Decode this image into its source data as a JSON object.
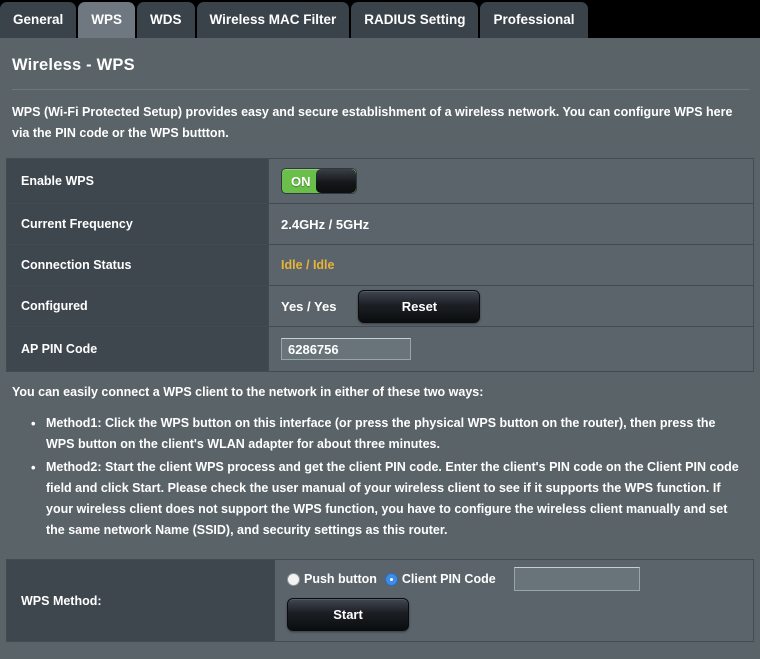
{
  "tabs": [
    {
      "label": "General",
      "active": false
    },
    {
      "label": "WPS",
      "active": true
    },
    {
      "label": "WDS",
      "active": false
    },
    {
      "label": "Wireless MAC Filter",
      "active": false
    },
    {
      "label": "RADIUS Setting",
      "active": false
    },
    {
      "label": "Professional",
      "active": false
    }
  ],
  "page": {
    "title": "Wireless - WPS",
    "description": "WPS (Wi-Fi Protected Setup) provides easy and secure establishment of a wireless network. You can configure WPS here via the PIN code or the WPS buttton."
  },
  "settings": {
    "enable_wps": {
      "label": "Enable WPS",
      "toggle_state": "ON"
    },
    "current_frequency": {
      "label": "Current Frequency",
      "value": "2.4GHz / 5GHz"
    },
    "connection_status": {
      "label": "Connection Status",
      "value": "Idle / Idle"
    },
    "configured": {
      "label": "Configured",
      "value": "Yes / Yes",
      "reset_label": "Reset"
    },
    "ap_pin_code": {
      "label": "AP PIN Code",
      "value": "6286756",
      "placeholder": ""
    }
  },
  "methods": {
    "intro": "You can easily connect a WPS client to the network in either of these two ways:",
    "items": [
      "Method1: Click the WPS button on this interface (or press the physical WPS button on the router), then press the WPS button on the client's WLAN adapter for about three minutes.",
      "Method2: Start the client WPS process and get the client PIN code. Enter the client's PIN code on the Client PIN code field and click Start. Please check the user manual of your wireless client to see if it supports the WPS function. If your wireless client does not support the WPS function, you have to configure the wireless client manually and set the same network Name (SSID), and security settings as this router."
    ]
  },
  "wps_method": {
    "label": "WPS Method:",
    "options": [
      {
        "label": "Push button",
        "selected": false
      },
      {
        "label": "Client PIN Code",
        "selected": true
      }
    ],
    "client_pin_value": "",
    "client_pin_placeholder": "",
    "start_label": "Start"
  },
  "colors": {
    "page_background": "#5a6368",
    "tabbar_background": "#000000",
    "tab_inactive": "#3a424a",
    "tab_active": "#6f7780",
    "label_cell": "#3e464e",
    "value_cell": "#5a646a",
    "toggle_on": "#6abf4b",
    "status_text": "#e8b33b",
    "radio_selected": "#3c8ce8"
  }
}
